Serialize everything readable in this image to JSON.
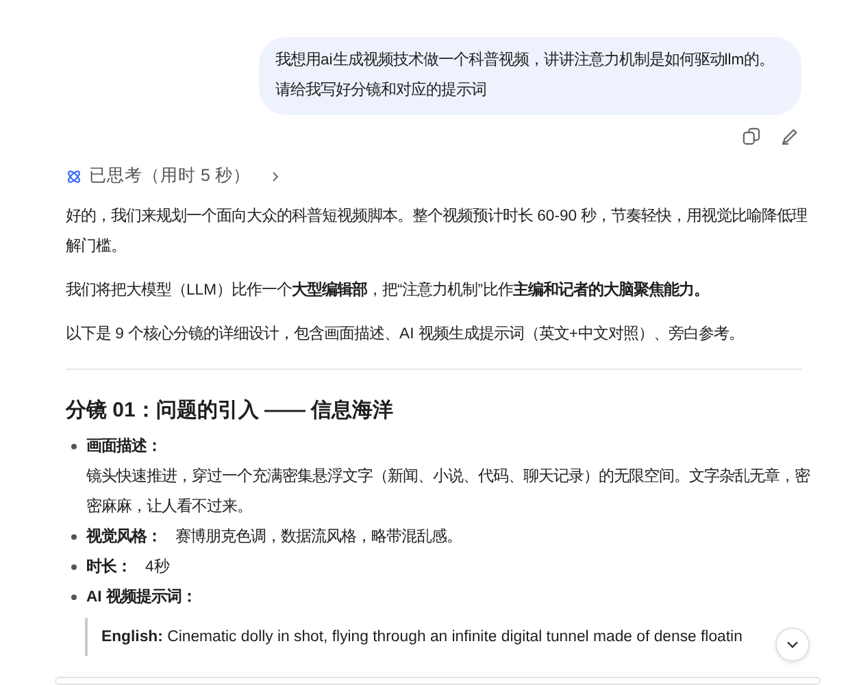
{
  "user_message": {
    "text": "我想用ai生成视频技术做一个科普视频，讲讲注意力机制是如何驱动llm的。请给我写好分镜和对应的提示词"
  },
  "thinking": {
    "label": "已思考（用时 5 秒）",
    "expanded": false
  },
  "paragraphs": [
    "好的，我们来规划一个面向大众的科普短视频脚本。整个视频预计时长 60-90 秒，节奏轻快，用视觉比喻降低理解门槛。",
    "我们将把大模型（LLM）比作一个**大型编辑部**，把“注意力机制”比作**主编和记者的大脑聚焦能力。**",
    "以下是 9 个核心分镜的详细设计，包含画面描述、AI 视频生成提示词（英文+中文对照）、旁白参考。"
  ],
  "section": {
    "heading": "分镜 01：问题的引入 —— 信息海洋",
    "bullets": [
      {
        "kind": "stacked",
        "label": "画面描述：",
        "text": "镜头快速推进，穿过一个充满密集悬浮文字（新闻、小说、代码、聊天记录）的无限空间。文字杂乱无章，密密麻麻，让人看不过来。"
      },
      {
        "kind": "inline",
        "label": "视觉风格：",
        "text": "赛博朋克色调，数据流风格，略带混乱感。"
      },
      {
        "kind": "inline",
        "label": "时长：",
        "text": "4秒"
      },
      {
        "kind": "label",
        "label": "AI 视频提示词："
      }
    ],
    "quote": {
      "label": "English:",
      "text": "Cinematic dolly in shot, flying through an infinite digital tunnel made of dense floatin"
    }
  }
}
